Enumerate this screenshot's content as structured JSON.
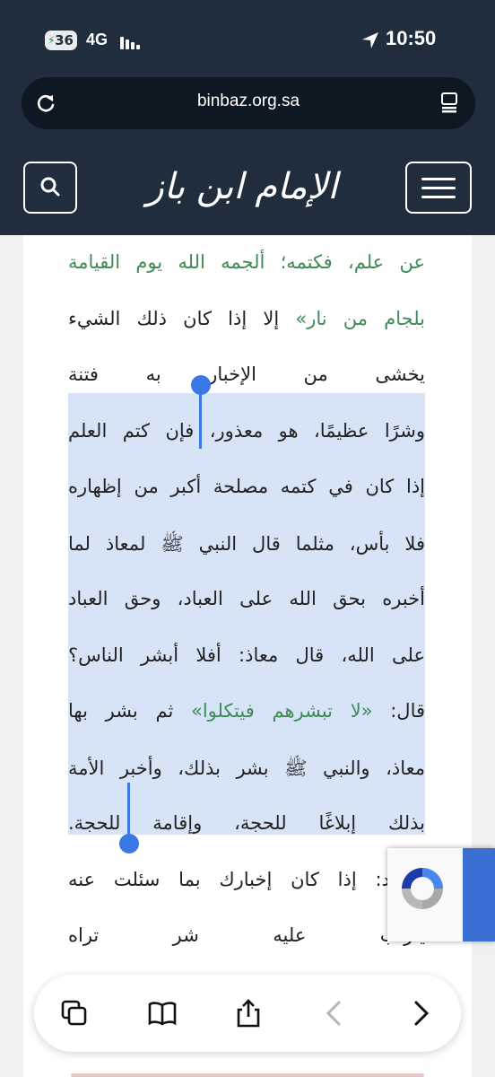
{
  "status_bar": {
    "battery": "36",
    "network": "4G",
    "time": "10:50"
  },
  "browser": {
    "url": "binbaz.org.sa"
  },
  "header": {
    "logo_text": "الإمام ابن باز"
  },
  "article": {
    "lines": [
      {
        "parts": [
          {
            "text": "عن علم، فكتمه؛ ألجمه الله يوم القيامة",
            "green": true
          }
        ]
      },
      {
        "parts": [
          {
            "text": "بلجام من نار»",
            "green": true
          },
          {
            "text": " إلا إذا كان ذلك الشيء",
            "green": false
          }
        ]
      },
      {
        "parts": [
          {
            "text": "يخشى من الإخبار به فتنة",
            "green": false
          }
        ]
      },
      {
        "parts": [
          {
            "text": "وشرًا عظيمًا، هو معذور، فإن كتم العلم",
            "green": false
          }
        ]
      },
      {
        "parts": [
          {
            "text": "إذا كان في كتمه مصلحة أكبر من إظهاره",
            "green": false
          }
        ]
      },
      {
        "parts": [
          {
            "text": "فلا بأس، مثلما قال النبي ﷺ لمعاذ لما",
            "green": false
          }
        ]
      },
      {
        "parts": [
          {
            "text": "أخبره بحق الله على العباد، وحق العباد",
            "green": false
          }
        ]
      },
      {
        "parts": [
          {
            "text": "على الله، قال معاذ: أفلا أبشر الناس؟",
            "green": false
          }
        ]
      },
      {
        "parts": [
          {
            "text": "قال: ",
            "green": false
          },
          {
            "text": "«لا تبشرهم فيتكلوا»",
            "green": true
          },
          {
            "text": " ثم بشر بها",
            "green": false
          }
        ]
      },
      {
        "parts": [
          {
            "text": "معاذ، والنبي ﷺ بشر بذلك، وأخبر الأمة",
            "green": false
          }
        ]
      },
      {
        "parts": [
          {
            "text": "بذلك إبلاغًا للحجة، وإقامة للحجة.",
            "green": false
          }
        ]
      },
      {
        "parts": [
          {
            "text": "فصود: إذا كان إخبارك بما سئلت عنه",
            "green": false
          }
        ]
      },
      {
        "parts": [
          {
            "text": "يترتب عليه شر تراه",
            "green": false
          }
        ]
      }
    ]
  },
  "toolbar": {
    "icons": [
      "tabs-icon",
      "bookmarks-icon",
      "share-icon",
      "back-icon",
      "forward-icon"
    ]
  }
}
